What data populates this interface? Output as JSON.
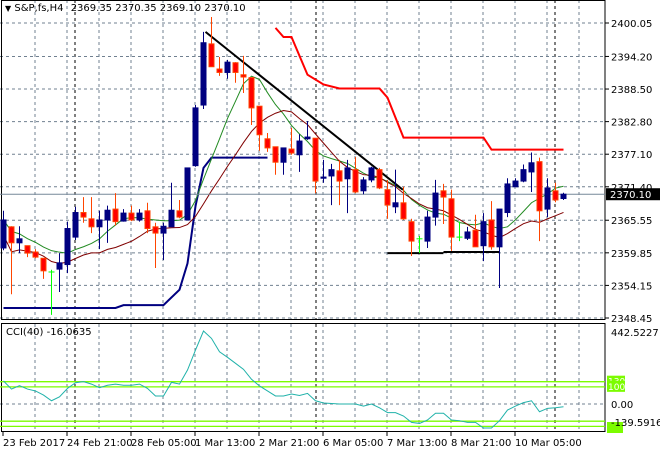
{
  "header": {
    "symbol": "S&P,fs,H4",
    "ohlc": "2369.35 2370.35 2369.10 2370.10"
  },
  "chart_data": [
    {
      "type": "candlestick",
      "title": "S&P,fs,H4",
      "ylim": [
        2348.45,
        2400.05
      ],
      "y_ticks": [
        "2400.05",
        "2394.20",
        "2388.50",
        "2382.80",
        "2377.10",
        "2371.40",
        "2365.55",
        "2359.85",
        "2354.15",
        "2348.45"
      ],
      "current_price": "2370.10",
      "x_ticks": [
        "23 Feb 2017",
        "24 Feb 21:00",
        "28 Feb 05:00",
        "1 Mar 13:00",
        "2 Mar 21:00",
        "6 Mar 05:00",
        "7 Mar 13:00",
        "8 Mar 21:00",
        "10 Mar 05:00"
      ],
      "grid": true,
      "candles_ohlc": [
        [
          2360.7,
          2367.2,
          2360.3,
          2365.6
        ],
        [
          2364.4,
          2364.5,
          2352.6,
          2361.6
        ],
        [
          2361.6,
          2364.5,
          2359.8,
          2362.3
        ],
        [
          2361.1,
          2361.1,
          2359.1,
          2359.8
        ],
        [
          2360.0,
          2360.5,
          2358.9,
          2359.1
        ],
        [
          2358.9,
          2358.9,
          2355.3,
          2356.7
        ],
        [
          2356.5,
          2356.9,
          2349.0,
          2356.5
        ],
        [
          2357.0,
          2359.8,
          2353.0,
          2358.1
        ],
        [
          2357.8,
          2365.3,
          2356.3,
          2364.1
        ],
        [
          2362.6,
          2367.9,
          2362.1,
          2366.9
        ],
        [
          2366.9,
          2369.6,
          2365.1,
          2366.1
        ],
        [
          2365.8,
          2369.6,
          2363.3,
          2364.4
        ],
        [
          2364.4,
          2367.2,
          2360.5,
          2365.6
        ],
        [
          2365.6,
          2368.1,
          2361.6,
          2367.3
        ],
        [
          2367.5,
          2370.3,
          2364.6,
          2365.3
        ],
        [
          2365.4,
          2367.5,
          2365.3,
          2366.8
        ],
        [
          2366.8,
          2368.1,
          2365.4,
          2365.6
        ],
        [
          2365.6,
          2367.5,
          2365.3,
          2366.8
        ],
        [
          2367.2,
          2368.6,
          2363.3,
          2364.1
        ],
        [
          2364.4,
          2365.1,
          2357.2,
          2363.3
        ],
        [
          2363.3,
          2365.1,
          2358.6,
          2364.5
        ],
        [
          2364.4,
          2372.1,
          2364.4,
          2367.3
        ],
        [
          2367.2,
          2369.1,
          2365.9,
          2366.1
        ],
        [
          2365.6,
          2374.7,
          2365.6,
          2374.7
        ],
        [
          2375.1,
          2385.7,
          2374.9,
          2385.2
        ],
        [
          2385.7,
          2398.5,
          2385.0,
          2396.6
        ],
        [
          2396.4,
          2401.1,
          2392.4,
          2392.4
        ],
        [
          2392.0,
          2394.1,
          2390.8,
          2391.4
        ],
        [
          2391.4,
          2393.6,
          2390.3,
          2393.2
        ],
        [
          2393.1,
          2393.2,
          2389.6,
          2391.4
        ],
        [
          2391.0,
          2394.3,
          2387.8,
          2390.6
        ],
        [
          2390.5,
          2390.5,
          2382.2,
          2385.2
        ],
        [
          2385.5,
          2385.5,
          2377.7,
          2380.5
        ],
        [
          2379.8,
          2380.8,
          2377.5,
          2378.2
        ],
        [
          2378.4,
          2378.4,
          2373.5,
          2375.7
        ],
        [
          2375.7,
          2378.2,
          2373.5,
          2378.2
        ],
        [
          2378.0,
          2381.7,
          2377.0,
          2377.3
        ],
        [
          2377.0,
          2380.6,
          2374.0,
          2379.4
        ],
        [
          2379.8,
          2382.9,
          2379.6,
          2380.1
        ],
        [
          2379.9,
          2379.9,
          2370.3,
          2372.4
        ],
        [
          2372.9,
          2376.1,
          2372.1,
          2373.1
        ],
        [
          2373.3,
          2375.4,
          2368.2,
          2374.4
        ],
        [
          2374.2,
          2376.1,
          2368.2,
          2372.4
        ],
        [
          2372.8,
          2376.1,
          2366.8,
          2374.7
        ],
        [
          2374.4,
          2376.6,
          2370.3,
          2370.5
        ],
        [
          2370.7,
          2373.1,
          2370.1,
          2372.6
        ],
        [
          2372.6,
          2374.9,
          2372.2,
          2374.7
        ],
        [
          2374.4,
          2374.7,
          2371.0,
          2371.2
        ],
        [
          2370.9,
          2372.6,
          2365.8,
          2368.2
        ],
        [
          2367.9,
          2374.4,
          2366.8,
          2368.6
        ],
        [
          2368.6,
          2371.4,
          2365.6,
          2365.8
        ],
        [
          2365.3,
          2365.8,
          2359.3,
          2361.9
        ],
        [
          2362.3,
          2362.8,
          2359.8,
          2362.3
        ],
        [
          2361.9,
          2367.2,
          2360.7,
          2366.1
        ],
        [
          2366.1,
          2372.6,
          2364.6,
          2370.3
        ],
        [
          2370.7,
          2371.9,
          2364.9,
          2369.6
        ],
        [
          2369.3,
          2370.9,
          2360.2,
          2362.6
        ],
        [
          2362.6,
          2365.3,
          2361.9,
          2362.6
        ],
        [
          2362.4,
          2364.4,
          2362.1,
          2363.5
        ],
        [
          2363.8,
          2366.5,
          2360.9,
          2360.9
        ],
        [
          2361.1,
          2366.8,
          2358.4,
          2365.3
        ],
        [
          2365.6,
          2368.9,
          2360.4,
          2360.9
        ],
        [
          2360.9,
          2367.5,
          2353.7,
          2367.5
        ],
        [
          2366.9,
          2372.9,
          2366.1,
          2371.9
        ],
        [
          2371.4,
          2372.9,
          2371.4,
          2372.4
        ],
        [
          2372.4,
          2375.3,
          2372.2,
          2374.4
        ],
        [
          2374.0,
          2377.4,
          2370.5,
          2375.6
        ],
        [
          2375.8,
          2376.5,
          2361.9,
          2367.2
        ],
        [
          2367.5,
          2372.9,
          2366.1,
          2371.2
        ],
        [
          2370.7,
          2372.1,
          2368.7,
          2369.1
        ],
        [
          2369.35,
          2370.35,
          2369.1,
          2370.1
        ]
      ],
      "lower_step_line": [
        [
          0,
          2350.2
        ],
        [
          14,
          2350.2
        ],
        [
          15,
          2350.7
        ],
        [
          20,
          2350.7
        ],
        [
          22,
          2353.4
        ],
        [
          23,
          2358
        ],
        [
          24,
          2368
        ],
        [
          25,
          2374.7
        ],
        [
          26,
          2376.5
        ],
        [
          33,
          2376.5
        ]
      ],
      "upper_step_line": [
        [
          34,
          2399.2
        ],
        [
          35,
          2397.6
        ],
        [
          36,
          2397.6
        ],
        [
          38,
          2391.0
        ],
        [
          40,
          2389.3
        ],
        [
          42,
          2388.6
        ],
        [
          47,
          2388.6
        ],
        [
          48,
          2387.0
        ],
        [
          50,
          2380.0
        ],
        [
          60,
          2380.0
        ],
        [
          61,
          2377.9
        ],
        [
          70,
          2377.9
        ]
      ],
      "trendlines": [
        {
          "from": [
            25.25,
            2398.5
          ],
          "to": [
            49.9,
            2370.9
          ],
          "color": "#000000"
        },
        {
          "from": [
            48,
            2359.8
          ],
          "to": [
            55,
            2359.8
          ],
          "color": "#000000"
        },
        {
          "from": [
            55,
            2360.0
          ],
          "to": [
            62,
            2360.0
          ],
          "color": "#000000"
        }
      ],
      "colors": {
        "bull": "#000080",
        "bear": "#ff0000",
        "bear_wick": "#ff4500",
        "doji": "#00ff00",
        "ma_fast": "#228b22",
        "ma_slow": "#800000",
        "upper": "#ff0000",
        "lower": "#000080"
      }
    },
    {
      "type": "line",
      "title": "CCI(40) -16.0635",
      "ylim": [
        -139.5916,
        442.5227
      ],
      "y_ticks": [
        "442.5227",
        "0.00",
        "-139.5916"
      ],
      "levels": [
        "130",
        "100",
        "-100",
        "-130"
      ],
      "level_values": [
        130,
        100,
        -100,
        -130
      ],
      "level_color": "#7cfc00",
      "line_color": "#20b2aa",
      "values": [
        134,
        87,
        107,
        87,
        76,
        52,
        19,
        42,
        91,
        124,
        130,
        116,
        95,
        109,
        116,
        109,
        109,
        116,
        91,
        47,
        47,
        126,
        116,
        198,
        314,
        425,
        382,
        304,
        272,
        237,
        202,
        144,
        105,
        76,
        47,
        47,
        58,
        50,
        62,
        19,
        6,
        3,
        0,
        0,
        0,
        -12,
        0,
        -22,
        -50,
        -50,
        -70,
        -107,
        -113,
        -93,
        -54,
        -54,
        -93,
        -97,
        -107,
        -107,
        -160,
        -160,
        -97,
        -35,
        -12,
        8,
        19,
        -45,
        -25,
        -22,
        -16.06
      ]
    }
  ]
}
